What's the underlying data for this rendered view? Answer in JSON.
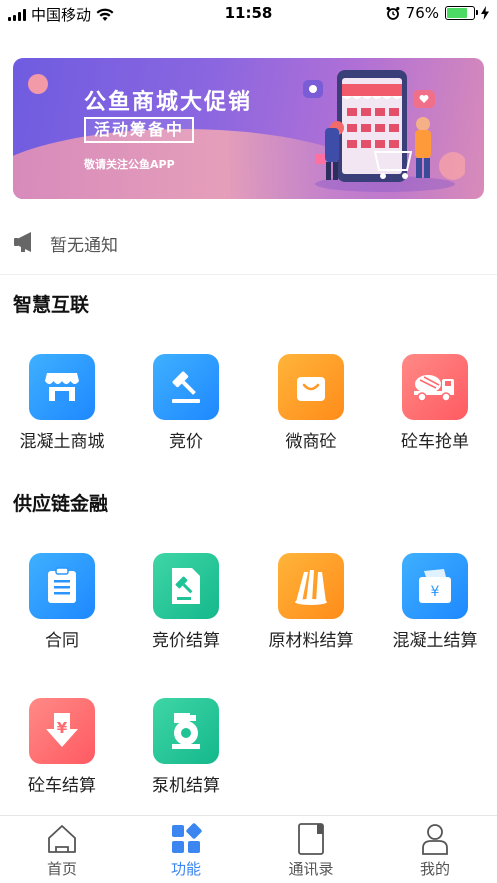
{
  "status_bar": {
    "carrier": "中国移动",
    "time": "11:58",
    "battery": "76%",
    "battery_level": 0.76
  },
  "banner": {
    "title": "公鱼商城大促销",
    "tag": "活动筹备中",
    "subtitle": "敬请关注公鱼APP"
  },
  "notice": {
    "icon": "megaphone-icon",
    "text": "暂无通知"
  },
  "sections": [
    {
      "title": "智慧互联",
      "items": [
        {
          "label": "混凝土商城",
          "icon": "store-icon",
          "color": "#2a95ff"
        },
        {
          "label": "竞价",
          "icon": "gavel-icon",
          "color": "#2a95ff"
        },
        {
          "label": "微商砼",
          "icon": "shopping-bag-icon",
          "color": "#ff9a24"
        },
        {
          "label": "砼车抢单",
          "icon": "mixer-truck-icon",
          "color": "#ff6a70"
        }
      ]
    },
    {
      "title": "供应链金融",
      "items": [
        {
          "label": "合同",
          "icon": "clipboard-icon",
          "color": "#2a95ff"
        },
        {
          "label": "竞价结算",
          "icon": "document-gavel-icon",
          "color": "#1fc396"
        },
        {
          "label": "原材料结算",
          "icon": "materials-icon",
          "color": "#ff9a24"
        },
        {
          "label": "混凝土结算",
          "icon": "wallet-icon",
          "color": "#2a95ff"
        },
        {
          "label": "砼车结算",
          "icon": "yen-download-icon",
          "color": "#ff6a70"
        },
        {
          "label": "泵机结算",
          "icon": "pump-icon",
          "color": "#1fc396"
        }
      ]
    }
  ],
  "tabbar": {
    "tabs": [
      {
        "label": "首页",
        "icon": "home-icon",
        "active": false
      },
      {
        "label": "功能",
        "icon": "grid-icon",
        "active": true
      },
      {
        "label": "通讯录",
        "icon": "contacts-icon",
        "active": false
      },
      {
        "label": "我的",
        "icon": "user-icon",
        "active": false
      }
    ],
    "active_color": "#3b86f0"
  }
}
